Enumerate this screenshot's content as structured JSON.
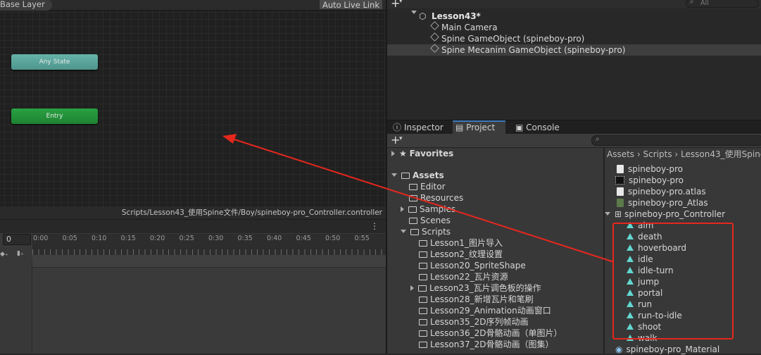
{
  "animator": {
    "layer_label": "Base Layer",
    "live_link_label": "Auto Live Link",
    "any_state": "Any State",
    "entry": "Entry",
    "controller_path": "Scripts/Lesson43_使用Spine文件/Boy/spineboy-pro_Controller.controller"
  },
  "timeline": {
    "frame_value": "0",
    "menu_dots": "⋮",
    "ticks": [
      "0:00",
      "0:05",
      "0:10",
      "0:15",
      "0:20",
      "0:25",
      "0:30",
      "0:35",
      "0:40",
      "0:45",
      "0:50",
      "0:55"
    ]
  },
  "hierarchy": {
    "add_label": "+",
    "search_placeholder": "All",
    "scene": "Lesson43*",
    "items": [
      "Main Camera",
      "Spine GameObject (spineboy-pro)",
      "Spine Mecanim GameObject (spineboy-pro)"
    ]
  },
  "tabs": {
    "inspector": "Inspector",
    "project": "Project",
    "console": "Console"
  },
  "project": {
    "add_label": "+",
    "favorites": "Favorites",
    "assets": "Assets",
    "folders": [
      "Editor",
      "Resources",
      "Samples",
      "Scenes",
      "Scripts"
    ],
    "scripts_children": [
      "Lesson1_图片导入",
      "Lesson2_纹理设置",
      "Lesson20_SpriteShape",
      "Lesson22_瓦片资源",
      "Lesson23_瓦片调色板的操作",
      "Lesson28_新增瓦片和笔刷",
      "Lesson29_Animation动画窗口",
      "Lesson35_2D序列帧动画",
      "Lesson36_2D骨骼动画（单图片）",
      "Lesson37_2D骨骼动画（图集）"
    ],
    "breadcrumb": [
      "Assets",
      "Scripts",
      "Lesson43_使用Spine"
    ],
    "files": [
      "spineboy-pro",
      "spineboy-pro",
      "spineboy-pro.atlas",
      "spineboy-pro_Atlas",
      "spineboy-pro_Controller"
    ],
    "clips": [
      "aim",
      "death",
      "hoverboard",
      "idle",
      "idle-turn",
      "jump",
      "portal",
      "run",
      "run-to-idle",
      "shoot",
      "walk"
    ],
    "material": "spineboy-pro_Material"
  },
  "colors": {
    "annotation_red": "#e6271d",
    "selection_blue": "#3a79bb",
    "any_state": "#5fa89f",
    "entry": "#239a3b"
  }
}
